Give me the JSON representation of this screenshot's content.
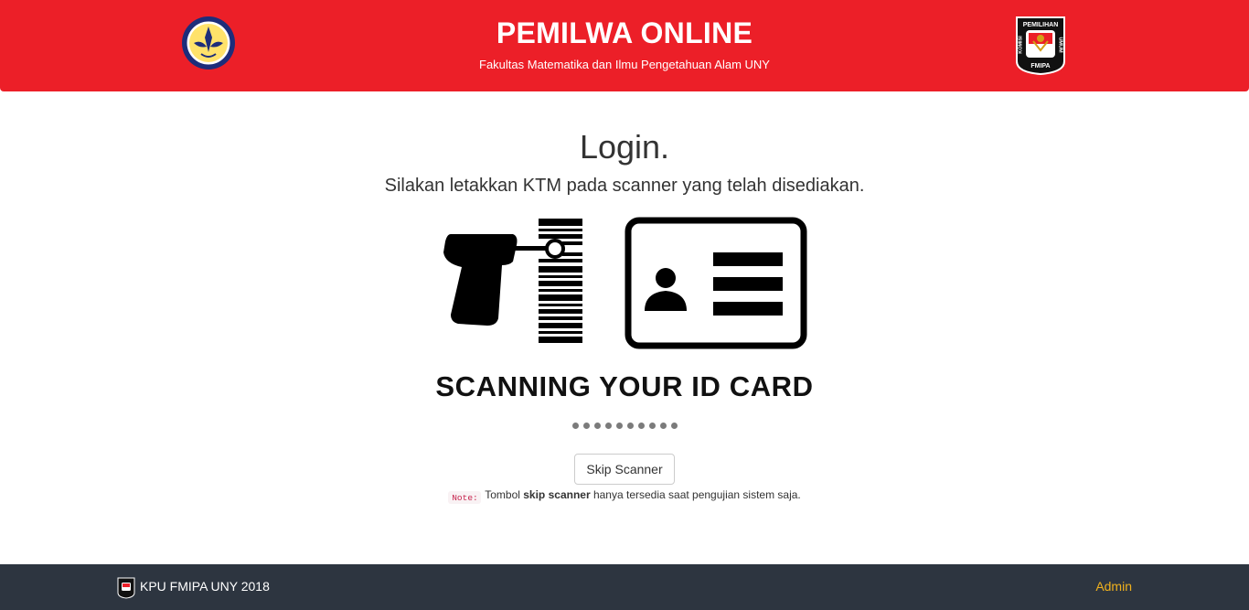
{
  "header": {
    "title": "PEMILWA ONLINE",
    "subtitle": "Fakultas Matematika dan Ilmu Pengetahuan Alam UNY",
    "left_logo": "uny-seal-logo",
    "right_logo": "kpu-fmipa-logo",
    "right_logo_text": {
      "top": "PEMILIHAN",
      "left": "KOMISI",
      "right": "UMUM",
      "bottom": "FMIPA"
    },
    "background_color": "#ec1f28"
  },
  "main": {
    "title": "Login.",
    "instruction": "Silakan letakkan KTM pada scanner yang telah disediakan.",
    "illustration": "barcode-scanner-id-card-illustration",
    "scan_caption": "SCANNING YOUR ID CARD",
    "loading_dot_count": 10,
    "skip_button_label": "Skip Scanner",
    "note": {
      "label": "Note:",
      "prefix": "Tombol ",
      "emphasis": "skip scanner",
      "suffix": " hanya tersedia saat pengujian sistem saja."
    }
  },
  "footer": {
    "text": "KPU FMIPA UNY 2018",
    "admin_link": "Admin",
    "background_color": "#2d3540",
    "link_color": "#f0b11d"
  }
}
